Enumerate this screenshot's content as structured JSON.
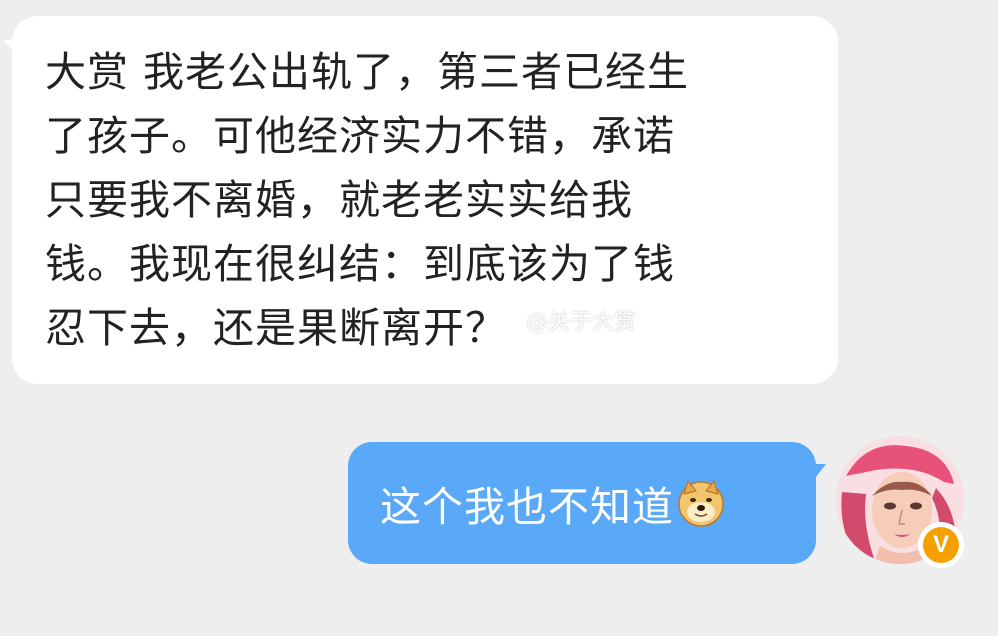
{
  "incoming": {
    "text": "大赏 我老公出轨了，第三者已经生\n了孩子。可他经济实力不错，承诺\n只要我不离婚，就老老实实给我\n钱。我现在很纠结：到底该为了钱\n忍下去，还是果断离开？"
  },
  "watermark": {
    "text": "@关于大赏",
    "icon": "weibo-icon"
  },
  "outgoing": {
    "text": "这个我也不知道",
    "emoji": "doge-icon"
  },
  "avatar": {
    "icon": "avatar-image"
  },
  "badge": {
    "label": "V",
    "color": "#f5a000"
  },
  "colors": {
    "background": "#eeeeee",
    "incoming_bubble": "#ffffff",
    "outgoing_bubble": "#5aa9f8"
  }
}
